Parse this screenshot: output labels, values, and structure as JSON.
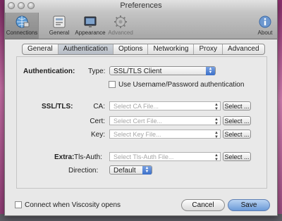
{
  "window": {
    "title": "Preferences"
  },
  "toolbar": {
    "items": [
      {
        "label": "Connections",
        "icon": "connections-icon",
        "selected": true
      },
      {
        "label": "General",
        "icon": "general-icon"
      },
      {
        "label": "Appearance",
        "icon": "appearance-icon"
      },
      {
        "label": "Advanced",
        "icon": "advanced-gear-icon"
      },
      {
        "label": "About",
        "icon": "about-info-icon"
      }
    ]
  },
  "tabs": {
    "items": [
      "General",
      "Authentication",
      "Options",
      "Networking",
      "Proxy",
      "Advanced"
    ],
    "active": "Authentication"
  },
  "authentication": {
    "section_label": "Authentication:",
    "type_label": "Type:",
    "type_value": "SSL/TLS Client",
    "userpass_checkbox_label": "Use Username/Password authentication",
    "userpass_checked": false
  },
  "ssl_tls": {
    "section_label": "SSL/TLS:",
    "ca_label": "CA:",
    "ca_placeholder": "Select CA File...",
    "cert_label": "Cert:",
    "cert_placeholder": "Select Cert File...",
    "key_label": "Key:",
    "key_placeholder": "Select Key File...",
    "select_button": "Select ..."
  },
  "extra": {
    "section_label": "Extra:",
    "tls_auth_label": "Tls-Auth:",
    "tls_auth_placeholder": "Select Tls-Auth File...",
    "direction_label": "Direction:",
    "direction_value": "Default",
    "select_button": "Select ..."
  },
  "footer": {
    "connect_checkbox_label": "Connect when Viscosity opens",
    "connect_checked": false,
    "cancel_label": "Cancel",
    "save_label": "Save"
  },
  "colors": {
    "accent_blue": "#3b6fc8",
    "default_button": "#6b9ad8"
  }
}
